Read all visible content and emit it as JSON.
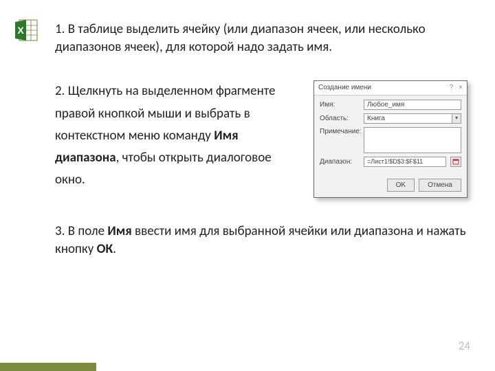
{
  "step1": "1. В таблице выделить ячейку (или диапазон ячеек, или несколько диапазонов ячеек), для которой надо задать имя.",
  "step2": {
    "prefix": "2. Щелкнуть на выделенном фрагменте правой кнопкой мыши и выбрать в контекстном меню команду ",
    "bold": "Имя диапазона",
    "suffix": ", чтобы открыть диалоговое окно."
  },
  "step3": {
    "prefix": "3. В поле ",
    "bold1": "Имя",
    "mid": " ввести имя для выбранной ячейки или диапазона и нажать кнопку ",
    "bold2": "ОК",
    "suffix": "."
  },
  "dialog": {
    "title": "Создание имени",
    "name_label": "Имя:",
    "name_value": "Любое_имя",
    "scope_label": "Область:",
    "scope_value": "Книга",
    "comment_label": "Примечание:",
    "range_label": "Диапазон:",
    "range_value": "=Лист1!$D$3:$F$11",
    "ok": "OK",
    "cancel": "Отмена"
  },
  "page_number": "24"
}
